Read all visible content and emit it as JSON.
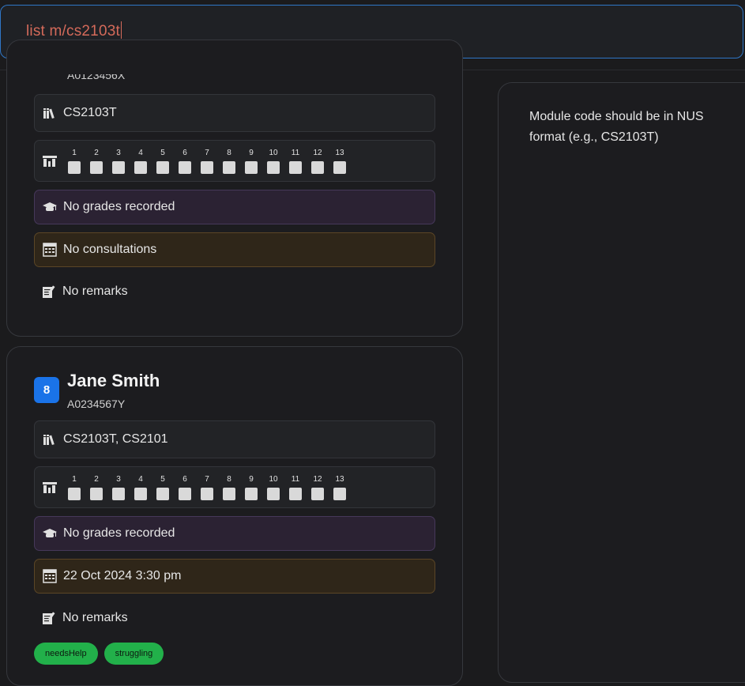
{
  "command": {
    "text": "list m/cs2103t"
  },
  "result": {
    "message": "Module code should be in NUS format (e.g., CS2103T)"
  },
  "weeks": [
    "1",
    "2",
    "3",
    "4",
    "5",
    "6",
    "7",
    "8",
    "9",
    "10",
    "11",
    "12",
    "13"
  ],
  "cards": [
    {
      "student_id_partial": "A0123456X",
      "modules": "CS2103T",
      "grades": "No grades recorded",
      "consultations": "No consultations",
      "remarks": "No remarks"
    },
    {
      "index": "8",
      "name": "Jane Smith",
      "student_id": "A0234567Y",
      "modules": "CS2103T, CS2101",
      "grades": "No grades recorded",
      "consultations": "22 Oct 2024 3:30 pm",
      "remarks": "No remarks",
      "tags": [
        "needsHelp",
        "struggling"
      ]
    }
  ],
  "colors": {
    "accent": "#1a73e8",
    "tag": "#22b04a",
    "command_text": "#d46a5a"
  }
}
